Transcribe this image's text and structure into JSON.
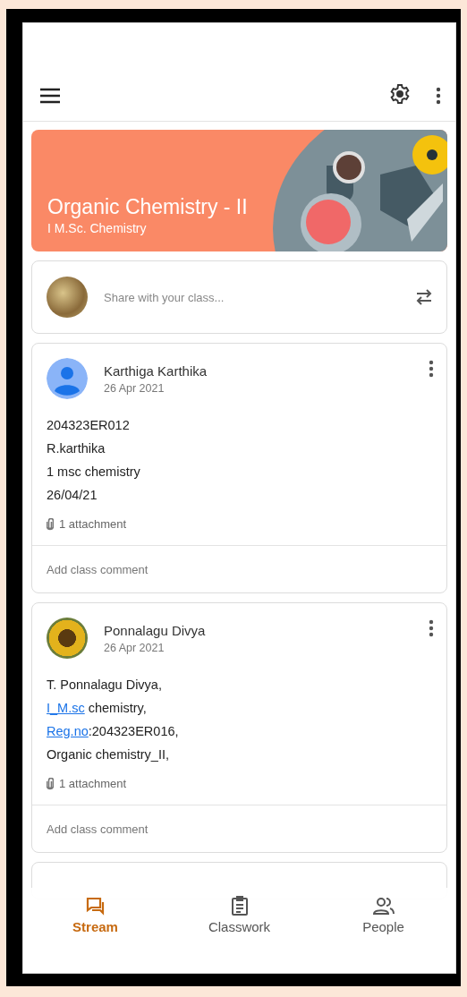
{
  "class_banner": {
    "title": "Organic Chemistry - II",
    "subtitle": "I M.Sc. Chemistry"
  },
  "share_box": {
    "placeholder": "Share with your class..."
  },
  "posts": [
    {
      "author": "Karthiga Karthika",
      "date": "26 Apr 2021",
      "kind": "default",
      "lines": [
        [
          {
            "kind": "text",
            "text": "204323ER012"
          }
        ],
        [
          {
            "kind": "text",
            "text": "R.karthika"
          }
        ],
        [
          {
            "kind": "text",
            "text": "1 msc chemistry"
          }
        ],
        [
          {
            "kind": "text",
            "text": "26/04/21"
          }
        ]
      ],
      "attachments": "1 attachment",
      "comment_placeholder": "Add class comment"
    },
    {
      "author": "Ponnalagu Divya",
      "date": "26 Apr 2021",
      "kind": "photo",
      "lines": [
        [
          {
            "kind": "text",
            "text": "T. Ponnalagu Divya,"
          }
        ],
        [
          {
            "kind": "link",
            "text": "I_M.sc"
          },
          {
            "kind": "text",
            "text": " chemistry,"
          }
        ],
        [
          {
            "kind": "link",
            "text": "Reg.no"
          },
          {
            "kind": "text",
            "text": ":204323ER016,"
          }
        ],
        [
          {
            "kind": "text",
            "text": "Organic chemistry_II,"
          }
        ]
      ],
      "attachments": "1 attachment",
      "comment_placeholder": "Add class comment"
    }
  ],
  "bottom_nav": [
    {
      "label": "Stream",
      "selected": true
    },
    {
      "label": "Classwork",
      "selected": false
    },
    {
      "label": "People",
      "selected": false
    }
  ]
}
